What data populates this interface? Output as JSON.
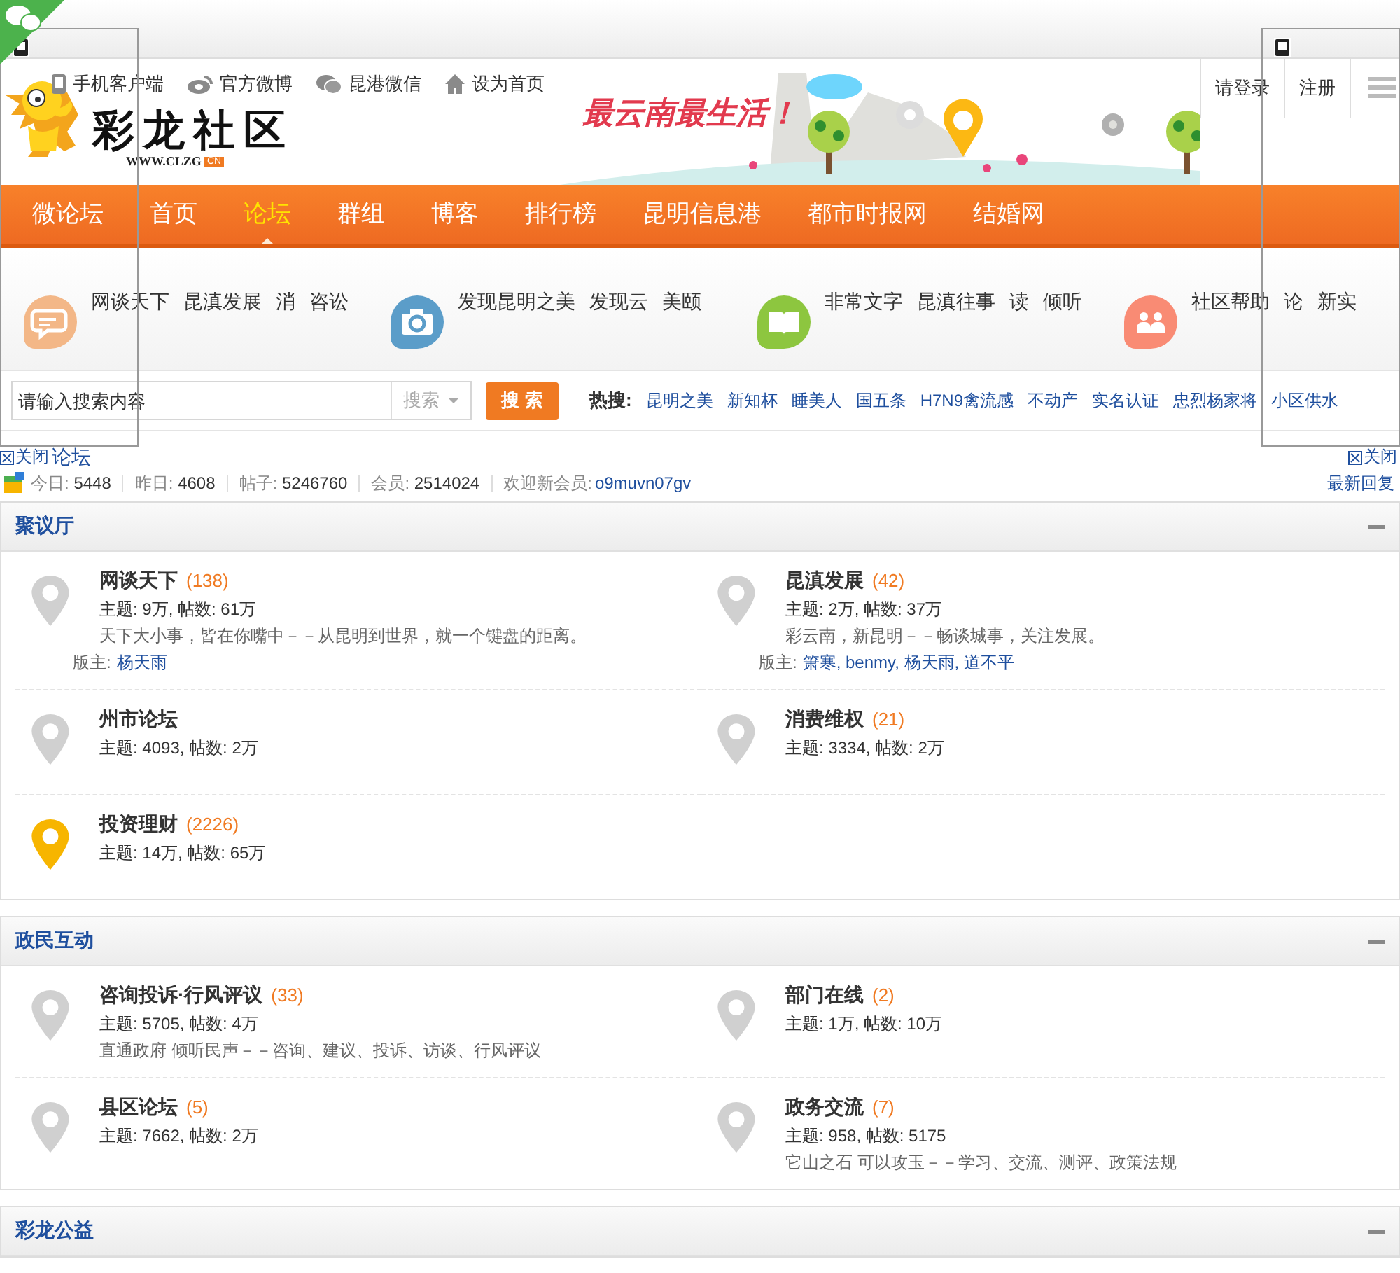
{
  "top_links": [
    {
      "label": "手机客户端"
    },
    {
      "label": "官方微博"
    },
    {
      "label": "昆港微信"
    },
    {
      "label": "设为首页"
    }
  ],
  "site": {
    "name": "彩龙社区",
    "url": "WWW.CLZG",
    "badge": "CN",
    "slogan": "最云南最生活！"
  },
  "account": [
    {
      "label": "请登录"
    },
    {
      "label": "注册"
    }
  ],
  "nav": [
    {
      "label": "微论坛",
      "selected": false
    },
    {
      "label": "首页",
      "selected": false
    },
    {
      "label": "论坛",
      "selected": true
    },
    {
      "label": "群组",
      "selected": false
    },
    {
      "label": "博客",
      "selected": false
    },
    {
      "label": "排行榜",
      "selected": false
    },
    {
      "label": "昆明信息港",
      "selected": false
    },
    {
      "label": "都市时报网",
      "selected": false
    },
    {
      "label": "结婚网",
      "selected": false
    }
  ],
  "channels": [
    {
      "color": "#f3b787",
      "links": [
        "网谈天下",
        "昆滇发展",
        "消",
        "咨讼"
      ]
    },
    {
      "color": "#5b9dc9",
      "links": [
        "发现昆明之美",
        "发现云",
        "美颐"
      ]
    },
    {
      "color": "#8dc63f",
      "links": [
        "非常文字",
        "昆滇往事",
        "读",
        "倾听"
      ]
    },
    {
      "color": "#f98b74",
      "links": [
        "社区帮助",
        "论",
        "新实"
      ]
    }
  ],
  "search": {
    "placeholder": "请输入搜索内容",
    "scope": "搜索",
    "button": "搜 索",
    "hot_label": "热搜:",
    "hot": [
      "昆明之美",
      "新知杯",
      "睡美人",
      "国五条",
      "H7N9禽流感",
      "不动产",
      "实名认证",
      "忠烈杨家将",
      "小区供水"
    ]
  },
  "ads": [
    {
      "close": "关闭"
    },
    {
      "close": "关闭"
    }
  ],
  "breadcrumb": "论坛",
  "stats": [
    {
      "label": "今日:",
      "value": "5448"
    },
    {
      "label": "昨日:",
      "value": "4608"
    },
    {
      "label": "帖子:",
      "value": "5246760"
    },
    {
      "label": "会员:",
      "value": "2514024"
    }
  ],
  "new_member": {
    "label": "欢迎新会员:",
    "name": "o9muvn07gv"
  },
  "latest": "最新回复",
  "sections": [
    {
      "title": "聚议厅",
      "forums": [
        {
          "name": "网谈天下",
          "count": "(138)",
          "stats": "主题: 9万, 帖数: 61万",
          "desc": "天下大小事，皆在你嘴中－－从昆明到世界，就一个键盘的距离。",
          "moderator_label": "版主:",
          "moderators": "杨天雨",
          "new": false
        },
        {
          "name": "昆滇发展",
          "count": "(42)",
          "stats": "主题: 2万, 帖数: 37万",
          "desc": "彩云南，新昆明－－畅谈城事，关注发展。",
          "moderator_label": "版主:",
          "moderators": "箫寒, benmy, 杨天雨, 道不平",
          "new": false
        },
        {
          "name": "州市论坛",
          "stats": "主题: 4093, 帖数: 2万",
          "new": false
        },
        {
          "name": "消费维权",
          "count": "(21)",
          "stats": "主题: 3334, 帖数: 2万",
          "new": false
        },
        {
          "name": "投资理财",
          "count": "(2226)",
          "stats": "主题: 14万, 帖数: 65万",
          "new": true
        }
      ]
    },
    {
      "title": "政民互动",
      "forums": [
        {
          "name": "咨询投诉·行风评议",
          "count": "(33)",
          "stats": "主题: 5705, 帖数: 4万",
          "desc": "直通政府 倾听民声－－咨询、建议、投诉、访谈、行风评议",
          "new": false
        },
        {
          "name": "部门在线",
          "count": "(2)",
          "stats": "主题: 1万, 帖数: 10万",
          "new": false
        },
        {
          "name": "县区论坛",
          "count": "(5)",
          "stats": "主题: 7662, 帖数: 2万",
          "new": false
        },
        {
          "name": "政务交流",
          "count": "(7)",
          "stats": "主题: 958, 帖数: 5175",
          "desc": "它山之石 可以攻玉－－学习、交流、测评、政策法规",
          "new": false
        }
      ]
    },
    {
      "title": "彩龙公益"
    }
  ]
}
